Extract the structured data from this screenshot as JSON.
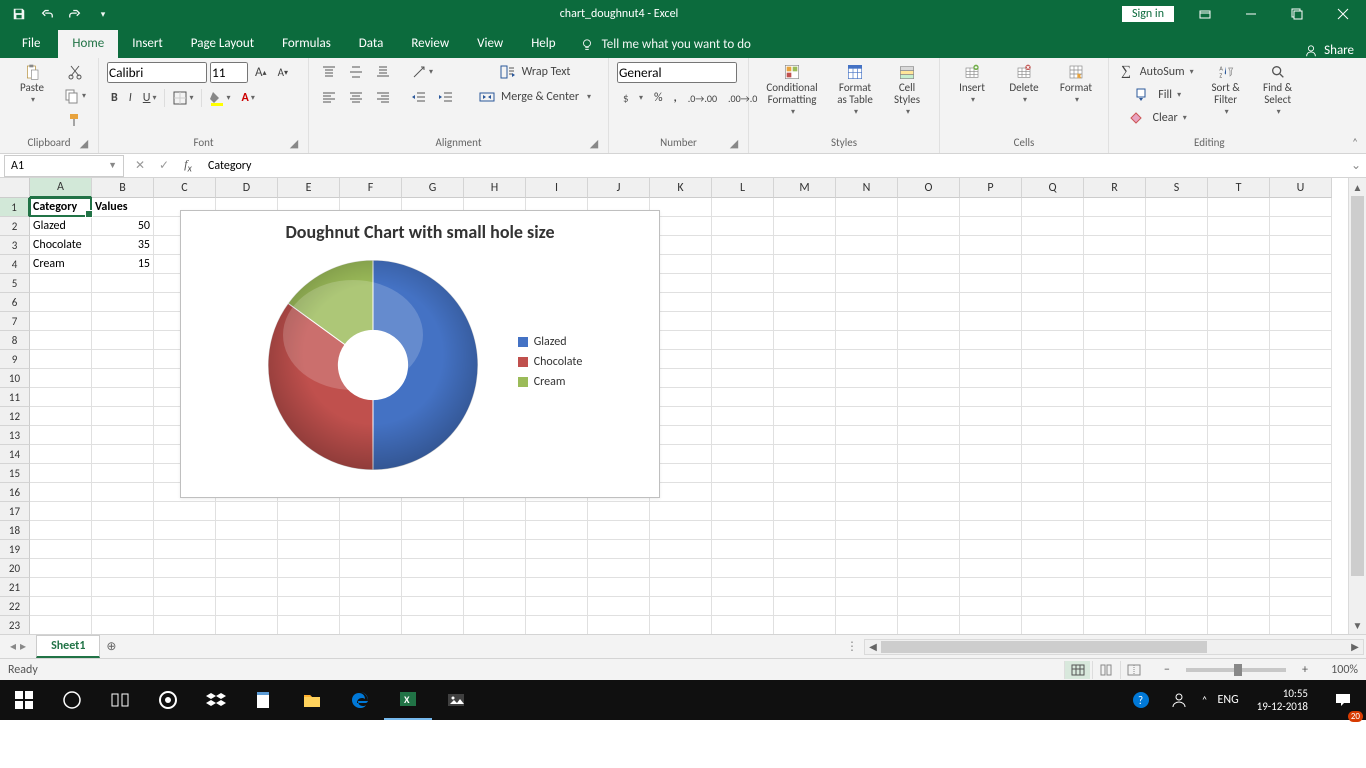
{
  "title": {
    "doc": "chart_doughnut4",
    "app": "Excel",
    "signin": "Sign in"
  },
  "tabs": {
    "file": "File",
    "home": "Home",
    "insert": "Insert",
    "page_layout": "Page Layout",
    "formulas": "Formulas",
    "data": "Data",
    "review": "Review",
    "view": "View",
    "help": "Help",
    "tell_me": "Tell me what you want to do",
    "share": "Share"
  },
  "ribbon": {
    "clipboard": {
      "paste": "Paste",
      "label": "Clipboard"
    },
    "font": {
      "name": "Calibri",
      "size": "11",
      "label": "Font"
    },
    "alignment": {
      "wrap": "Wrap Text",
      "merge": "Merge & Center",
      "label": "Alignment"
    },
    "number": {
      "format": "General",
      "label": "Number"
    },
    "styles": {
      "cond": "Conditional Formatting",
      "table": "Format as Table",
      "cell": "Cell Styles",
      "label": "Styles"
    },
    "cells": {
      "insert": "Insert",
      "delete": "Delete",
      "format": "Format",
      "label": "Cells"
    },
    "editing": {
      "sum": "AutoSum",
      "fill": "Fill",
      "clear": "Clear",
      "sort": "Sort & Filter",
      "find": "Find & Select",
      "label": "Editing"
    }
  },
  "formula_bar": {
    "name_box": "A1",
    "formula": "Category"
  },
  "grid": {
    "columns": [
      "A",
      "B",
      "C",
      "D",
      "E",
      "F",
      "G",
      "H",
      "I",
      "J",
      "K",
      "L",
      "M",
      "N",
      "O",
      "P",
      "Q",
      "R",
      "S",
      "T",
      "U"
    ],
    "rows": 23,
    "data": [
      [
        "Category",
        "Values"
      ],
      [
        "Glazed",
        "50"
      ],
      [
        "Chocolate",
        "35"
      ],
      [
        "Cream",
        "15"
      ]
    ],
    "bold_row": 0,
    "active": {
      "row": 0,
      "col": 0
    }
  },
  "chart_data": {
    "type": "pie",
    "title": "Doughnut Chart with small hole size",
    "categories": [
      "Glazed",
      "Chocolate",
      "Cream"
    ],
    "values": [
      50,
      35,
      15
    ],
    "colors": [
      "#4472c4",
      "#c0504d",
      "#9bbb59"
    ],
    "hole_ratio": 0.33
  },
  "sheet_tabs": {
    "active": "Sheet1"
  },
  "statusbar": {
    "ready": "Ready",
    "zoom": "100%"
  },
  "taskbar": {
    "lang": "ENG",
    "time": "10:55",
    "date": "19-12-2018",
    "notif": "20"
  }
}
